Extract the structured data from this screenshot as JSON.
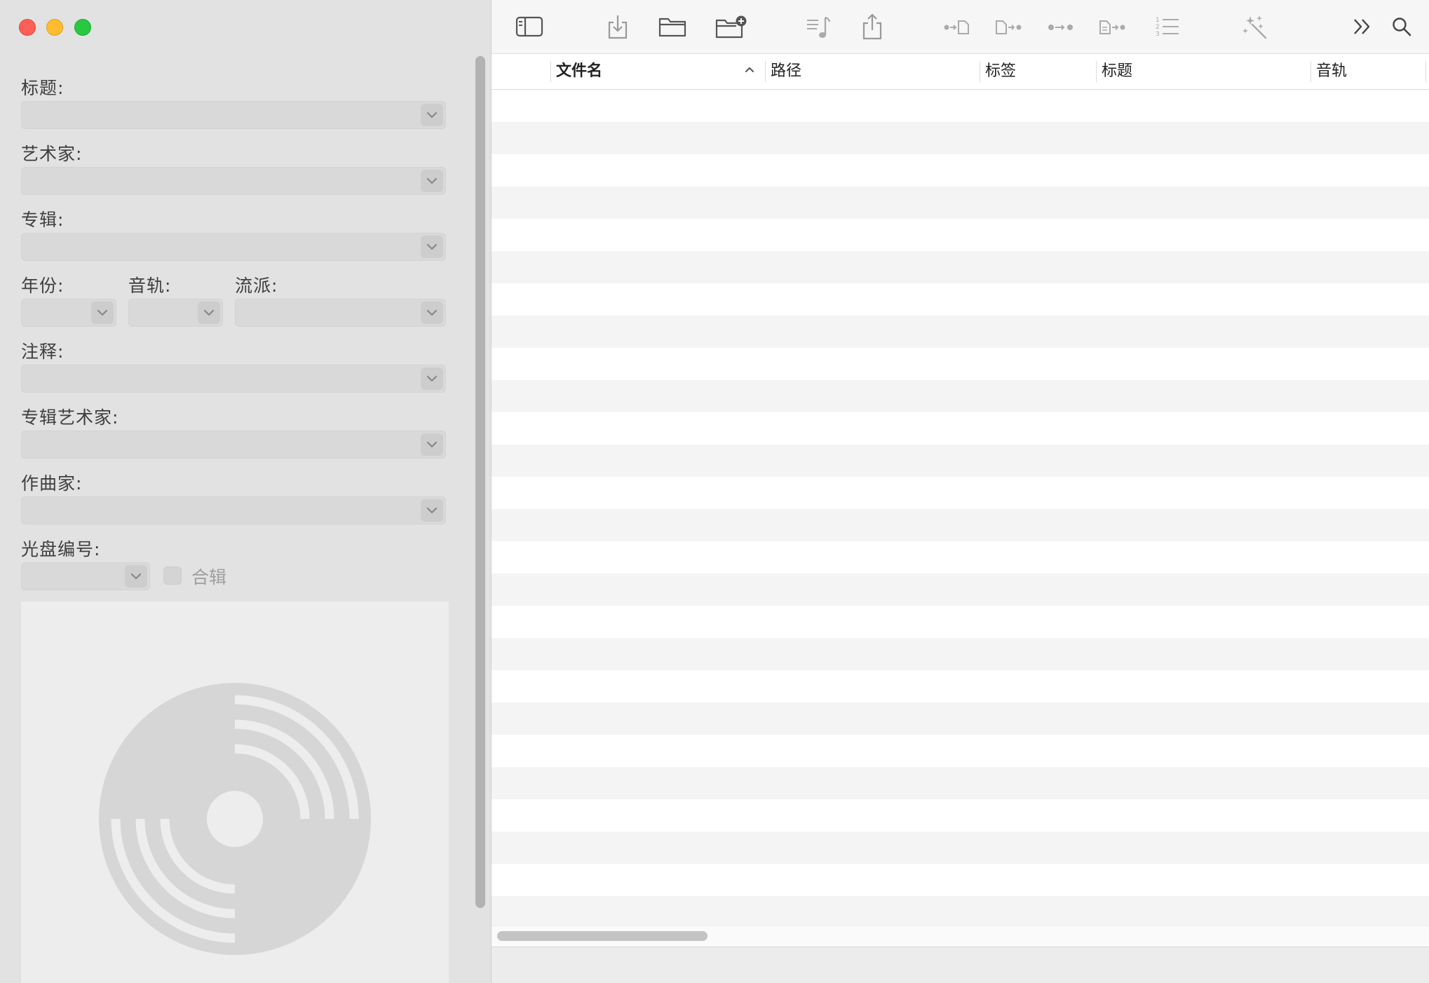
{
  "window": {
    "traffic_lights": {
      "close_color": "#fe5f57",
      "minimize_color": "#febc2e",
      "maximize_color": "#28c840"
    }
  },
  "sidebar": {
    "fields": {
      "title": "标题:",
      "artist": "艺术家:",
      "album": "专辑:",
      "year": "年份:",
      "track": "音轨:",
      "genre": "流派:",
      "comment": "注释:",
      "album_artist": "专辑艺术家:",
      "composer": "作曲家:",
      "disc_number": "光盘编号:"
    },
    "compilation_label": "合辑",
    "artwork_placeholder_icon": "cd-disc-icon"
  },
  "toolbar": {
    "icons": [
      "sidebar-toggle-icon",
      "import-icon",
      "open-folder-icon",
      "add-folder-icon",
      "playlist-icon",
      "share-icon",
      "tag-from-filename-icon",
      "filename-from-tag-icon",
      "tag-to-tag-icon",
      "tag-from-text-icon",
      "numbering-icon",
      "magic-wand-icon",
      "more-chevrons-icon",
      "search-icon"
    ]
  },
  "table": {
    "columns": {
      "filename": "文件名",
      "path": "路径",
      "tags": "标签",
      "title": "标题",
      "track": "音轨"
    },
    "sorted_column": "filename",
    "sort_direction": "ascending",
    "empty_rows": 26
  },
  "colors": {
    "sidebar_bg": "#e2e2e2",
    "row_alt": "#f4f4f5",
    "toolbar_bg": "#f6f6f6"
  }
}
